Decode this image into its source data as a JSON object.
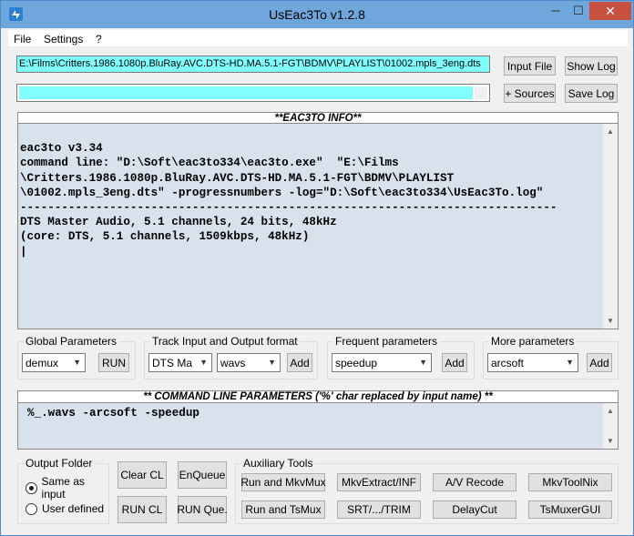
{
  "window": {
    "title": "UsEac3To v1.2.8",
    "min_glyph": "─",
    "max_glyph": "☐",
    "close_glyph": "✕"
  },
  "menu": {
    "file": "File",
    "settings": "Settings",
    "help": "?"
  },
  "paths": {
    "input_path": "E:\\Films\\Critters.1986.1080p.BluRay.AVC.DTS-HD.MA.5.1-FGT\\BDMV\\PLAYLIST\\01002.mpls_3eng.dts",
    "sources_value": ""
  },
  "buttons": {
    "input_file": "Input File",
    "show_log": "Show Log",
    "sources": "+ Sources",
    "save_log": "Save Log",
    "global_run": "RUN",
    "track_add": "Add",
    "freq_add": "Add",
    "more_add": "Add",
    "clear_cl": "Clear CL",
    "enqueue": "EnQueue",
    "run_cl": "RUN CL",
    "run_queue": "RUN Que."
  },
  "info": {
    "header": "**EAC3TO INFO**",
    "lines": [
      "eac3to v3.34",
      "command line: \"D:\\Soft\\eac3to334\\eac3to.exe\"  \"E:\\Films",
      "\\Critters.1986.1080p.BluRay.AVC.DTS-HD.MA.5.1-FGT\\BDMV\\PLAYLIST",
      "\\01002.mpls_3eng.dts\" -progressnumbers -log=\"D:\\Soft\\eac3to334\\UsEac3To.log\"",
      "------------------------------------------------------------------------------",
      "DTS Master Audio, 5.1 channels, 24 bits, 48kHz",
      "(core: DTS, 5.1 channels, 1509kbps, 48kHz)",
      "|"
    ]
  },
  "groups": {
    "global": {
      "label": "Global Parameters",
      "combo": "demux"
    },
    "track": {
      "label": "Track Input and Output format",
      "combo1": "DTS Ma",
      "combo2": "wavs"
    },
    "frequent": {
      "label": "Frequent parameters",
      "combo": "speedup"
    },
    "more": {
      "label": "More parameters",
      "combo": "arcsoft"
    }
  },
  "command": {
    "header": "** COMMAND LINE PARAMETERS ('%' char replaced by input name) **",
    "text": "%_.wavs -arcsoft -speedup"
  },
  "output_folder": {
    "label": "Output Folder",
    "same_as_input": "Same as input",
    "user_defined": "User defined",
    "selected": "same_as_input"
  },
  "aux": {
    "label": "Auxiliary Tools",
    "run_mkvmux": "Run and MkvMux",
    "mkvextract": "MkvExtract/INF",
    "av_recode": "A/V Recode",
    "mkvtoolnix": "MkvToolNix",
    "run_tsmux": "Run and TsMux",
    "srt_trim": "SRT/.../TRIM",
    "delaycut": "DelayCut",
    "tsmuxergui": "TsMuxerGUI"
  },
  "colors": {
    "input_bg": "#80ffff",
    "info_bg": "#d8e2ec",
    "titlebar": "#6fa6dc",
    "close": "#c7503f"
  }
}
